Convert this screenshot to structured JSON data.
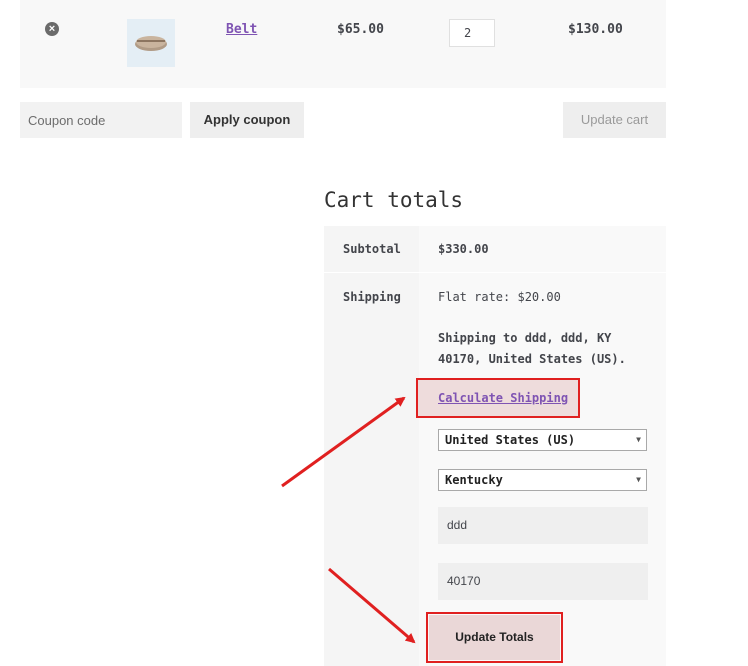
{
  "cart": {
    "remove_icon": "×",
    "product_thumb": "belt-image",
    "product_name": "Belt",
    "price": "$65.00",
    "quantity": "2",
    "line_total": "$130.00"
  },
  "actions": {
    "coupon_placeholder": "Coupon code",
    "apply_label": "Apply coupon",
    "update_cart_label": "Update cart"
  },
  "totals": {
    "title": "Cart totals",
    "subtotal_label": "Subtotal",
    "subtotal_value": "$330.00",
    "shipping_label": "Shipping",
    "flat_rate": "Flat rate: $20.00",
    "destination": "Shipping to ddd, ddd, KY 40170, United States (US).",
    "calculate_link": "Calculate Shipping",
    "country": "United States (US)",
    "state": "Kentucky",
    "city": "ddd",
    "postcode": "40170",
    "update_totals_label": "Update Totals"
  },
  "icons": {
    "remove": "remove-icon",
    "caret": "chevron-down-icon"
  },
  "colors": {
    "link": "#7f54b3",
    "highlight": "#e02020"
  }
}
